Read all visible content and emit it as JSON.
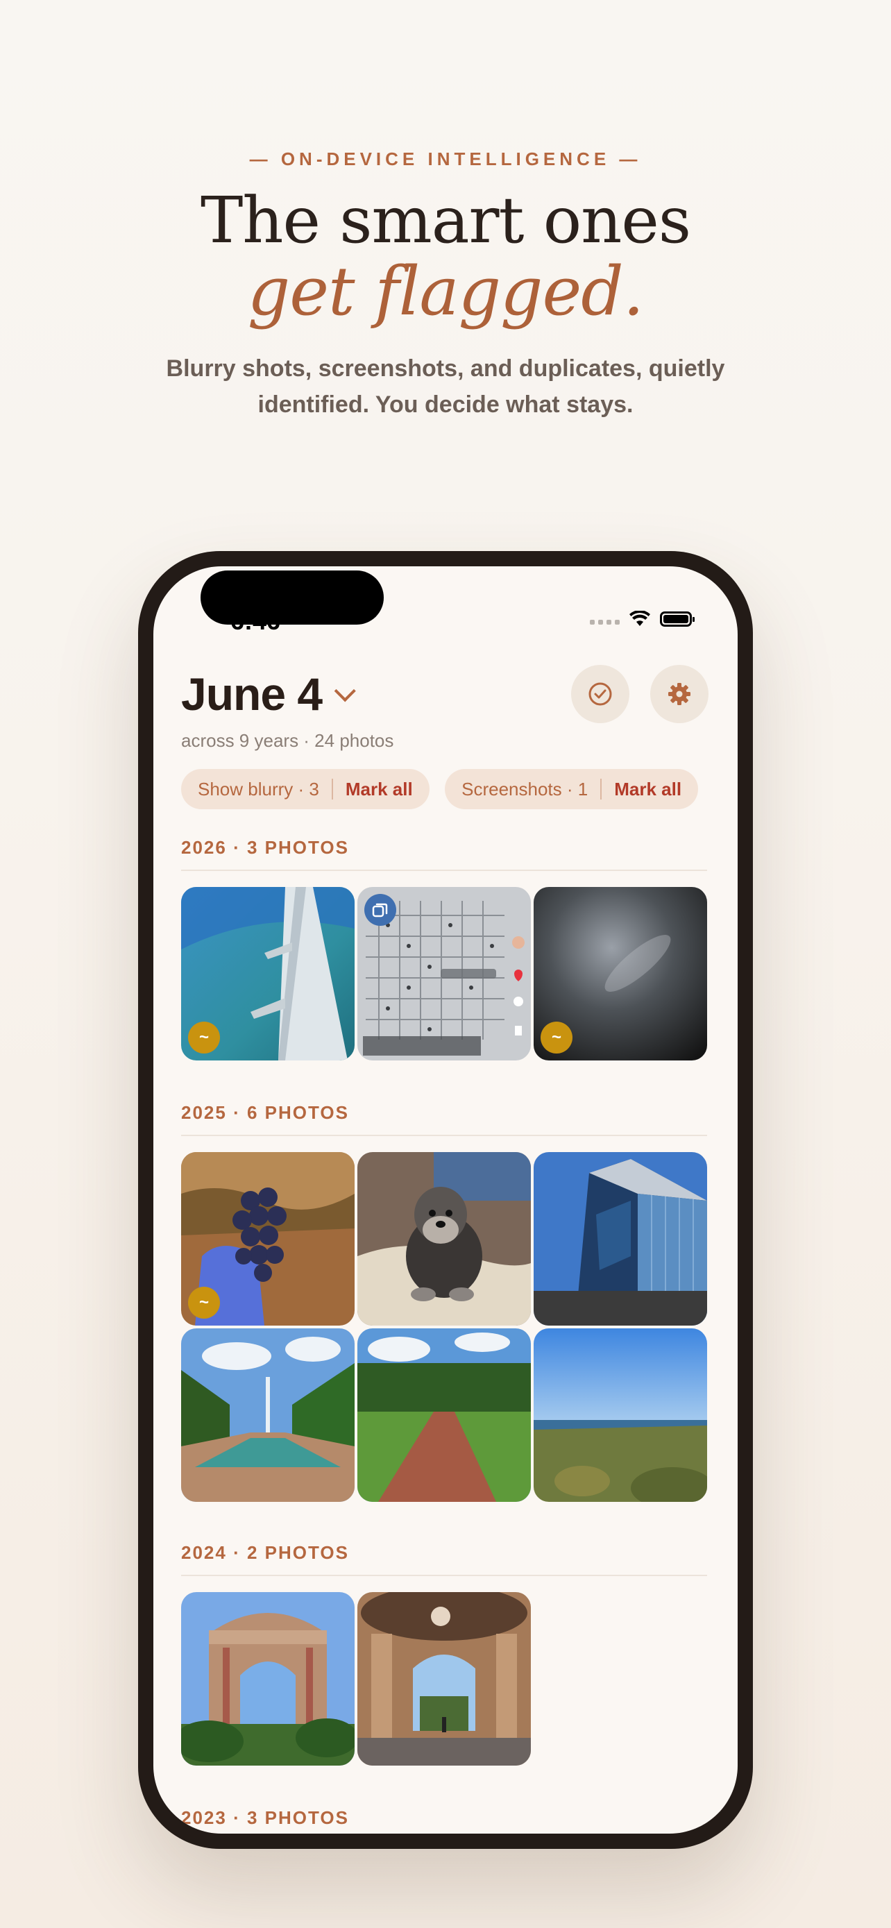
{
  "marketing": {
    "eyebrow": "— ON-DEVICE INTELLIGENCE —",
    "headline": "The smart ones",
    "headline_accent": "get flagged.",
    "subcopy": "Blurry shots, screenshots, and duplicates, quietly identified. You decide what stays."
  },
  "status_bar": {
    "time": "6:46"
  },
  "header": {
    "title": "June 4",
    "subtitle": "across 9 years · 24 photos",
    "select_icon": "checkmark-circle-icon",
    "settings_icon": "gear-icon"
  },
  "filters": [
    {
      "label": "Show blurry · 3",
      "action": "Mark all"
    },
    {
      "label": "Screenshots · 1",
      "action": "Mark all"
    }
  ],
  "sections": [
    {
      "heading": "2026 · 3 PHOTOS"
    },
    {
      "heading": "2025 · 6 PHOTOS"
    },
    {
      "heading": "2024 · 2 PHOTOS"
    },
    {
      "heading": "2023 · 3 PHOTOS"
    }
  ],
  "badges": {
    "blurry": "~"
  },
  "colors": {
    "accent": "#b5673f",
    "action": "#b23a28",
    "blurry_badge": "#c9930f",
    "screenshot_badge": "#3f6fb0"
  }
}
